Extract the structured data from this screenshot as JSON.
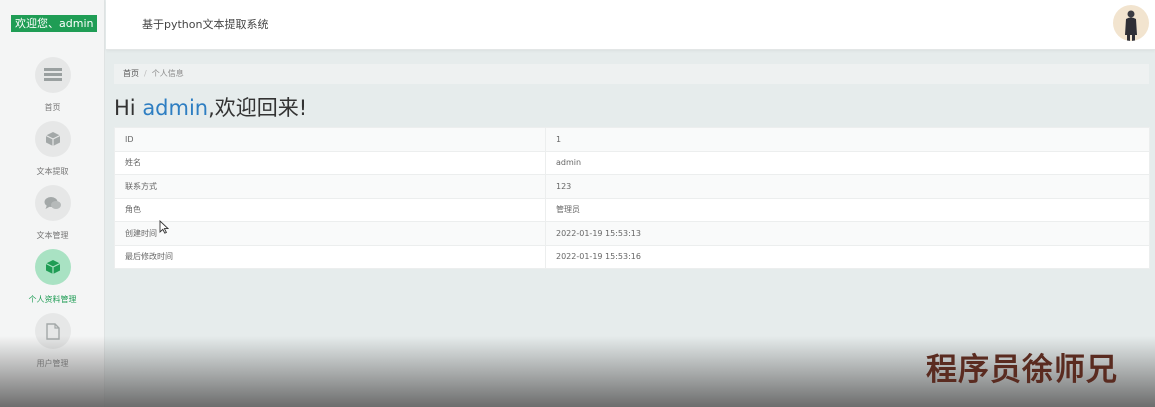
{
  "welcome": "欢迎您、admin",
  "system_title": "基于python文本提取系统",
  "nav": [
    {
      "label": "首页",
      "icon": "home-icon"
    },
    {
      "label": "文本提取",
      "icon": "cube-icon"
    },
    {
      "label": "文本管理",
      "icon": "chat-icon"
    },
    {
      "label": "个人资料管理",
      "icon": "cube-icon",
      "active": true
    },
    {
      "label": "用户管理",
      "icon": "file-icon"
    }
  ],
  "breadcrumb": {
    "home": "首页",
    "separator": "/",
    "current": "个人信息"
  },
  "greeting": {
    "prefix": "Hi ",
    "username": "admin",
    "suffix": ",欢迎回来!"
  },
  "profile": [
    {
      "label": "ID",
      "value": "1"
    },
    {
      "label": "姓名",
      "value": "admin"
    },
    {
      "label": "联系方式",
      "value": "123"
    },
    {
      "label": "角色",
      "value": "管理员"
    },
    {
      "label": "创建时间",
      "value": "2022-01-19 15:53:13"
    },
    {
      "label": "最后修改时间",
      "value": "2022-01-19 15:53:16"
    }
  ],
  "watermark": "程序员徐师兄",
  "colors": {
    "accent": "#1f9d55",
    "link": "#2e7ec2",
    "active_bg": "#a9e2c3"
  }
}
